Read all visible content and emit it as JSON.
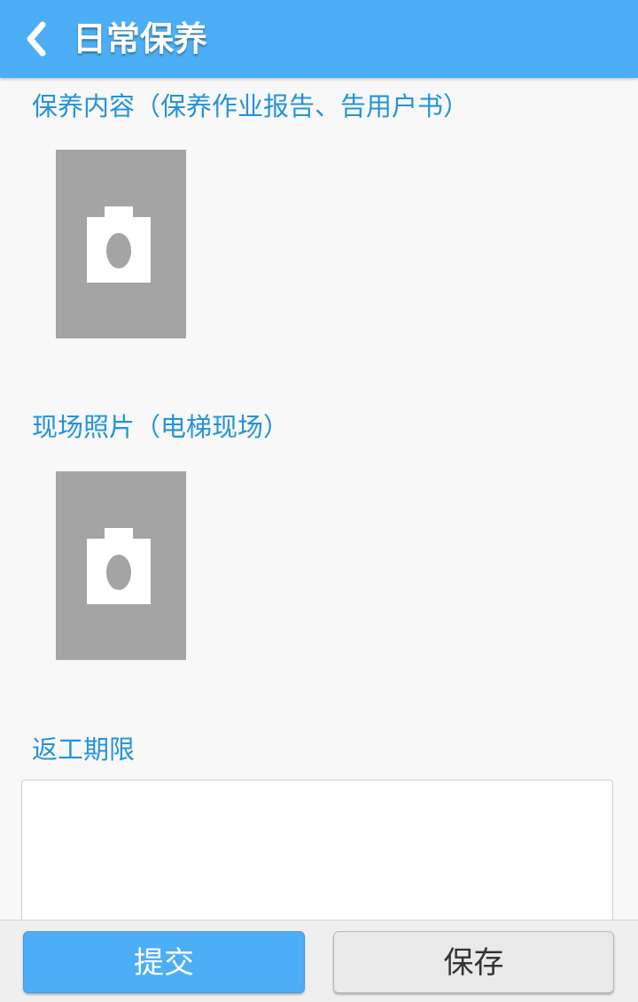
{
  "header": {
    "title": "日常保养",
    "back_icon": "chevron-left-icon",
    "color": "#4caef6"
  },
  "sections": {
    "maintenance_content": {
      "title": "保养内容（保养作业报告、告用户书）",
      "photo_icon": "camera-icon"
    },
    "site_photos": {
      "title": "现场照片（电梯现场）",
      "photo_icon": "camera-icon"
    },
    "rework_deadline": {
      "title": "返工期限",
      "value": ""
    }
  },
  "footer": {
    "submit_label": "提交",
    "save_label": "保存"
  },
  "colors": {
    "accent": "#4caef6",
    "section_title": "#2493d8",
    "photo_placeholder": "#a4a4a4"
  }
}
